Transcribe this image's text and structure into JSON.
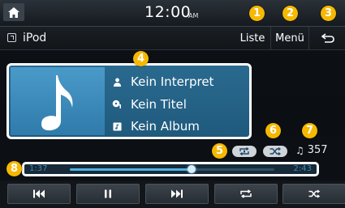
{
  "status": {
    "time": "12:00",
    "ampm": "AM"
  },
  "header": {
    "source_label": "iPod",
    "list_label": "Liste",
    "menu_label": "Menü"
  },
  "track": {
    "artist": "Kein Interpret",
    "title": "Kein Titel",
    "album": "Kein Album"
  },
  "playback": {
    "track_count": "357",
    "elapsed": "1:37",
    "total": "2:43",
    "progress_fraction": 0.595,
    "repeat_mode": "repeat-one",
    "shuffle_mode": "shuffle"
  },
  "callouts": [
    "1",
    "2",
    "3",
    "4",
    "5",
    "6",
    "7",
    "8"
  ],
  "colors": {
    "callout": "#f6b800",
    "accent": "#4fb1e6",
    "panel": "#2a6a8f"
  }
}
